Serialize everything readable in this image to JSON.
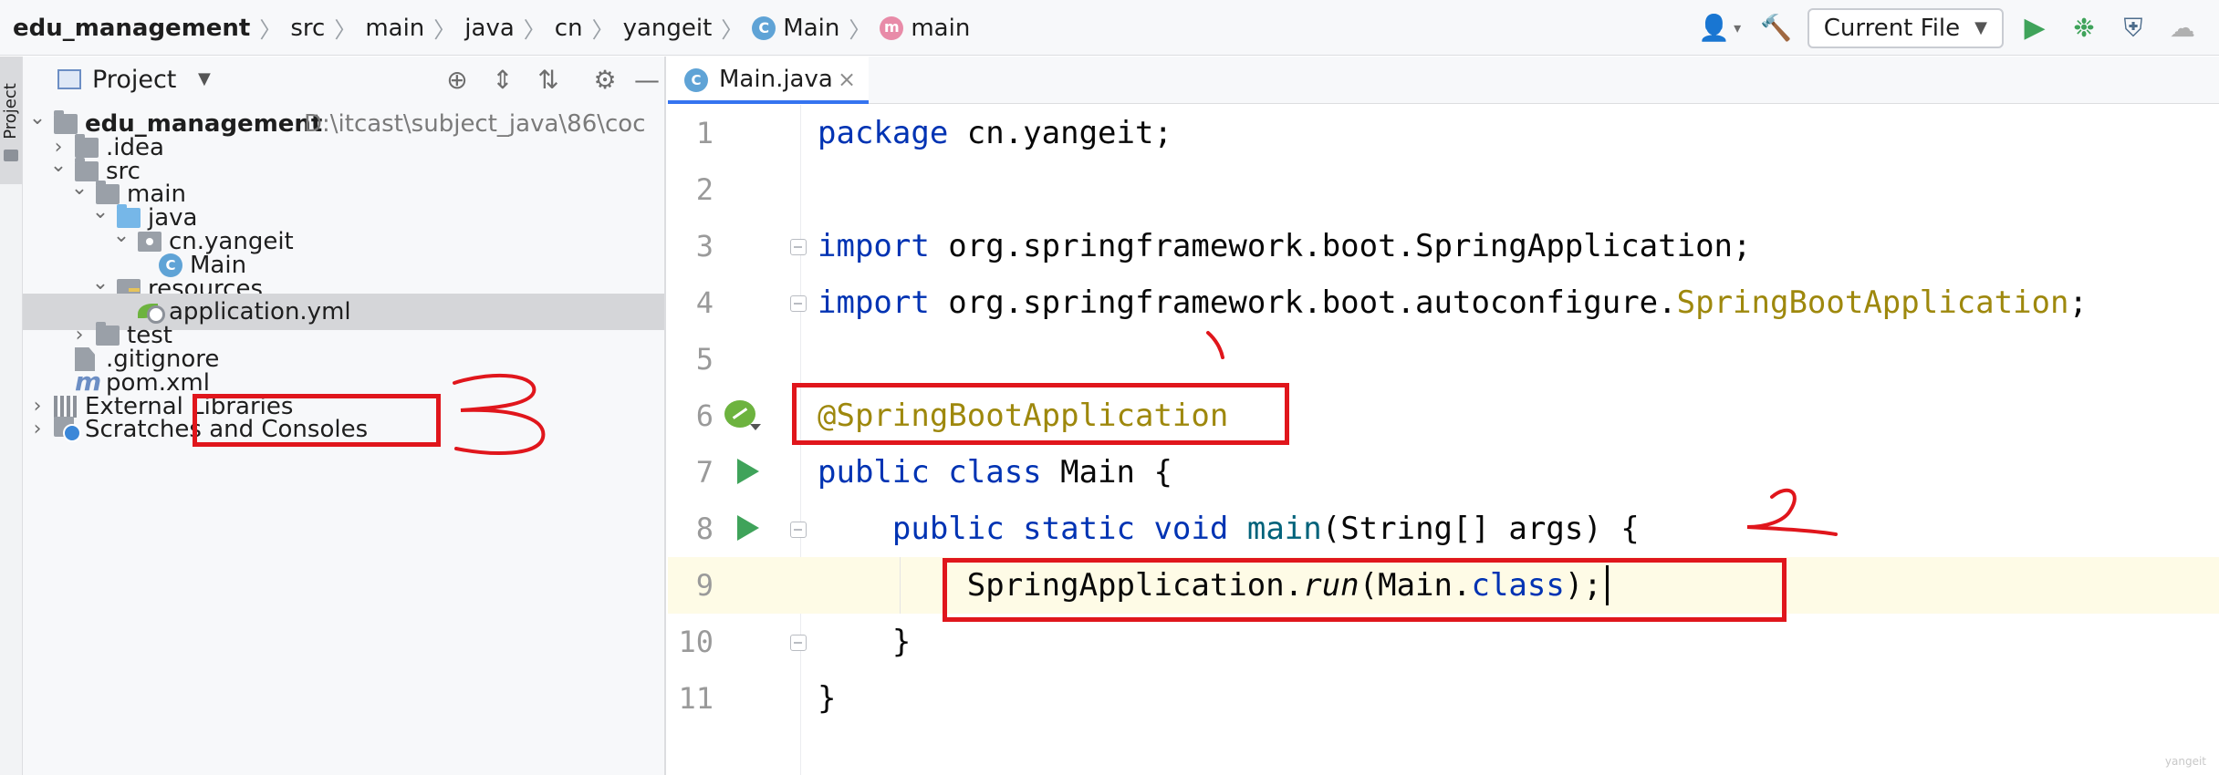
{
  "breadcrumbs": [
    {
      "label": "edu_management",
      "icon": "none"
    },
    {
      "label": "src",
      "icon": "none"
    },
    {
      "label": "main",
      "icon": "none"
    },
    {
      "label": "java",
      "icon": "none"
    },
    {
      "label": "cn",
      "icon": "none"
    },
    {
      "label": "yangeit",
      "icon": "none"
    },
    {
      "label": "Main",
      "icon": "class-icon"
    },
    {
      "label": "main",
      "icon": "method-icon"
    }
  ],
  "toolbar": {
    "run_config": "Current File",
    "icons": [
      "user-icon",
      "build-hammer-icon",
      "run-icon",
      "debug-icon",
      "coverage-icon",
      "profile-icon"
    ]
  },
  "left_strip": {
    "label": "Project"
  },
  "project_panel": {
    "title": "Project",
    "tree": [
      {
        "label": "edu_management",
        "path": "D:\\itcast\\subject_java\\86\\coc",
        "icon": "module-folder",
        "twisty": "open",
        "bold": true
      },
      {
        "label": ".idea",
        "icon": "folder",
        "twisty": "closed"
      },
      {
        "label": "src",
        "icon": "folder",
        "twisty": "open"
      },
      {
        "label": "main",
        "icon": "folder",
        "twisty": "open"
      },
      {
        "label": "java",
        "icon": "source-folder",
        "twisty": "open"
      },
      {
        "label": "cn.yangeit",
        "icon": "package",
        "twisty": "open"
      },
      {
        "label": "Main",
        "icon": "java-class",
        "twisty": "none"
      },
      {
        "label": "resources",
        "icon": "resources-folder",
        "twisty": "open"
      },
      {
        "label": "application.yml",
        "icon": "spring-yml",
        "twisty": "none",
        "selected": true
      },
      {
        "label": "test",
        "icon": "folder",
        "twisty": "closed"
      },
      {
        "label": ".gitignore",
        "icon": "gitignore-file",
        "twisty": "none"
      },
      {
        "label": "pom.xml",
        "icon": "maven-file",
        "twisty": "none"
      },
      {
        "label": "External Libraries",
        "icon": "libraries",
        "twisty": "closed"
      },
      {
        "label": "Scratches and Consoles",
        "icon": "scratches",
        "twisty": "closed"
      }
    ]
  },
  "editor": {
    "tab": {
      "label": "Main.java",
      "close": "×"
    },
    "lines": [
      {
        "n": "1",
        "tokens": [
          {
            "t": "package",
            "c": "kw"
          },
          {
            "t": " cn.yangeit;",
            "c": ""
          }
        ]
      },
      {
        "n": "2",
        "tokens": []
      },
      {
        "n": "3",
        "tokens": [
          {
            "t": "import",
            "c": "kw"
          },
          {
            "t": " org.springframework.boot.SpringApplication;",
            "c": ""
          }
        ]
      },
      {
        "n": "4",
        "tokens": [
          {
            "t": "import",
            "c": "kw"
          },
          {
            "t": " org.springframework.boot.autoconfigure.",
            "c": ""
          },
          {
            "t": "SpringBootApplication",
            "c": "ann"
          },
          {
            "t": ";",
            "c": ""
          }
        ]
      },
      {
        "n": "5",
        "tokens": []
      },
      {
        "n": "6",
        "tokens": [
          {
            "t": "@SpringBootApplication",
            "c": "ann"
          }
        ]
      },
      {
        "n": "7",
        "tokens": [
          {
            "t": "public class",
            "c": "kw"
          },
          {
            "t": " Main {",
            "c": ""
          }
        ]
      },
      {
        "n": "8",
        "tokens": [
          {
            "t": "    ",
            "c": ""
          },
          {
            "t": "public static void",
            "c": "kw"
          },
          {
            "t": " ",
            "c": ""
          },
          {
            "t": "main",
            "c": "mth"
          },
          {
            "t": "(String[] args) {",
            "c": ""
          }
        ]
      },
      {
        "n": "9",
        "tokens": [
          {
            "t": "        SpringApplication.",
            "c": ""
          },
          {
            "t": "run",
            "c": "ital"
          },
          {
            "t": "(Main.",
            "c": ""
          },
          {
            "t": "class",
            "c": "kw"
          },
          {
            "t": ");",
            "c": ""
          }
        ]
      },
      {
        "n": "10",
        "tokens": [
          {
            "t": "    }",
            "c": ""
          }
        ]
      },
      {
        "n": "11",
        "tokens": [
          {
            "t": "}",
            "c": ""
          }
        ]
      }
    ]
  },
  "annotations": {
    "marks": [
      "3",
      "2",
      "1"
    ],
    "color": "#e0161c"
  },
  "watermark": "yangeit"
}
